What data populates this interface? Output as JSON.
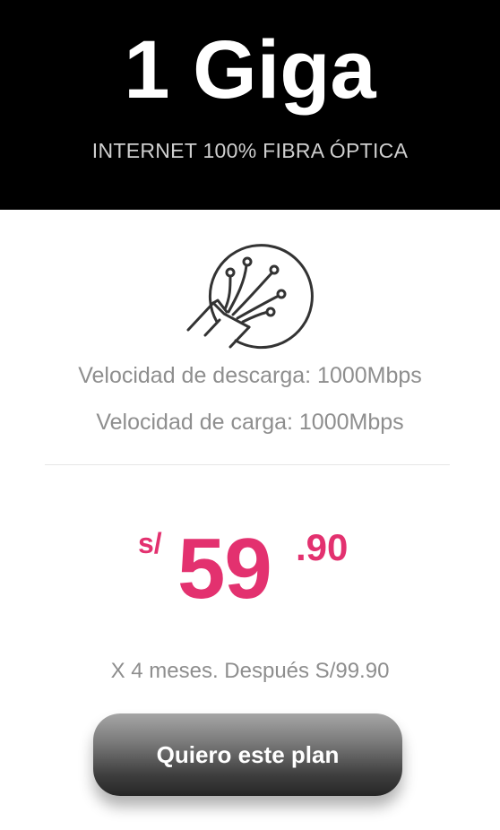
{
  "header": {
    "title": "1 Giga",
    "subtitle": "INTERNET 100% FIBRA ÓPTICA"
  },
  "icon": {
    "name": "fiber-optic-icon",
    "color": "#333333"
  },
  "specs": {
    "download": "Velocidad de descarga: 1000Mbps",
    "upload": "Velocidad de carga: 1000Mbps"
  },
  "price": {
    "currency": "s/",
    "integer": "59",
    "decimal": ".90",
    "note": "X 4 meses. Después S/99.90"
  },
  "cta": {
    "label": "Quiero este plan"
  },
  "colors": {
    "header_bg": "#000000",
    "accent": "#e3316f",
    "muted_text": "#8e8e8e"
  }
}
